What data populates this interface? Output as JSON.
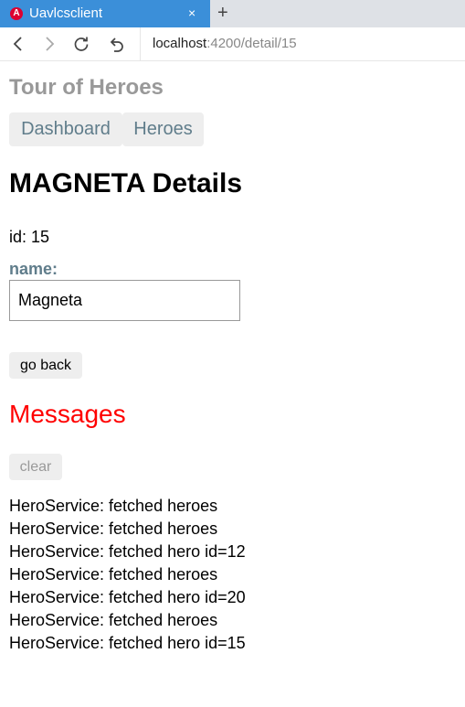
{
  "browser": {
    "tab_title": "Uavlcsclient",
    "favicon_letter": "A",
    "close_glyph": "×",
    "new_tab_glyph": "+",
    "url_host": "localhost",
    "url_path": ":4200/detail/15"
  },
  "app": {
    "title": "Tour of Heroes",
    "nav": {
      "dashboard": "Dashboard",
      "heroes": "Heroes"
    }
  },
  "hero": {
    "details_title": "MAGNETA Details",
    "id_line": "id: 15",
    "name_label": "name:",
    "name_value": "Magneta",
    "back_label": "go back"
  },
  "messages": {
    "title": "Messages",
    "clear_label": "clear",
    "items": [
      "HeroService: fetched heroes",
      "HeroService: fetched heroes",
      "HeroService: fetched hero id=12",
      "HeroService: fetched heroes",
      "HeroService: fetched hero id=20",
      "HeroService: fetched heroes",
      "HeroService: fetched hero id=15"
    ]
  },
  "colors": {
    "tab_active": "#3b8fd9",
    "app_title": "#999999",
    "nav_text": "#607d8b",
    "messages_title": "#ff0000"
  }
}
